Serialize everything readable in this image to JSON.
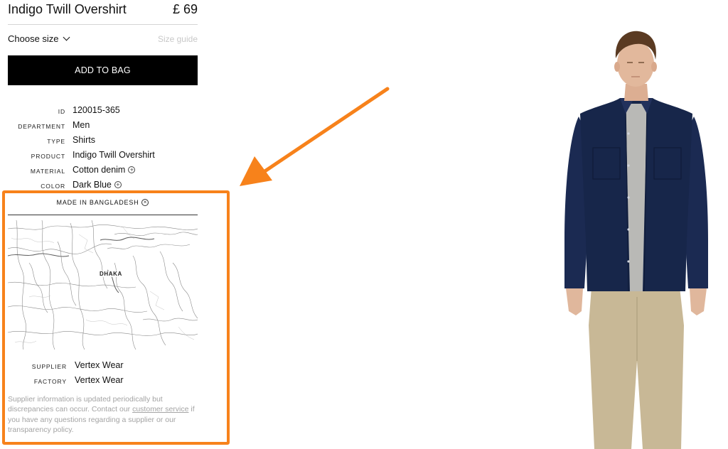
{
  "product": {
    "title": "Indigo Twill Overshirt",
    "price": "£ 69"
  },
  "size_selector": {
    "label": "Choose size",
    "guide_label": "Size guide"
  },
  "add_to_bag": {
    "label": "ADD TO BAG"
  },
  "specs": [
    {
      "label": "ID",
      "value": "120015-365",
      "expandable": false
    },
    {
      "label": "DEPARTMENT",
      "value": "Men",
      "expandable": false
    },
    {
      "label": "TYPE",
      "value": "Shirts",
      "expandable": false
    },
    {
      "label": "PRODUCT",
      "value": "Indigo Twill Overshirt",
      "expandable": false
    },
    {
      "label": "MATERIAL",
      "value": "Cotton denim",
      "expandable": true
    },
    {
      "label": "COLOR",
      "value": "Dark Blue",
      "expandable": true
    }
  ],
  "origin": {
    "heading": "MADE IN BANGLADESH",
    "map_city": "DHAKA",
    "supplier_label": "SUPPLIER",
    "supplier_value": "Vertex Wear",
    "factory_label": "FACTORY",
    "factory_value": "Vertex Wear",
    "note_before": "Supplier information is updated periodically but discrepancies can occur. Contact our ",
    "note_link": "customer service",
    "note_after": " if you have any questions regarding a supplier or our transparency policy."
  },
  "colors": {
    "highlight": "#f7821b",
    "button_bg": "#000000",
    "shirt": "#17264a",
    "trousers": "#c8b896"
  },
  "icons": {
    "expand": "plus-circle-icon",
    "close": "x-circle-icon",
    "dropdown": "chevron-down-icon",
    "annotation": "arrow-icon"
  }
}
